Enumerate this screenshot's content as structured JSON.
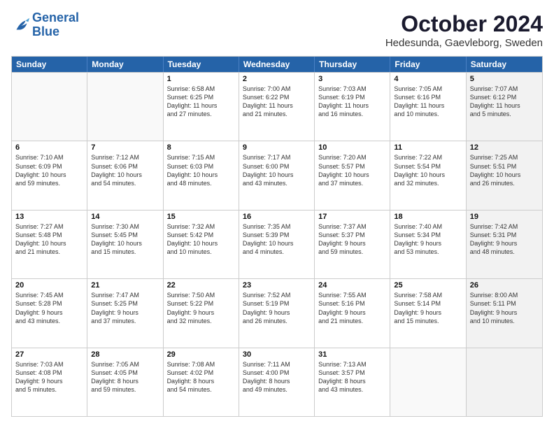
{
  "header": {
    "logo_general": "General",
    "logo_blue": "Blue",
    "month_title": "October 2024",
    "location": "Hedesunda, Gaevleborg, Sweden"
  },
  "weekdays": [
    "Sunday",
    "Monday",
    "Tuesday",
    "Wednesday",
    "Thursday",
    "Friday",
    "Saturday"
  ],
  "rows": [
    [
      {
        "day": "",
        "lines": [],
        "shaded": false,
        "empty": true
      },
      {
        "day": "",
        "lines": [],
        "shaded": false,
        "empty": true
      },
      {
        "day": "1",
        "lines": [
          "Sunrise: 6:58 AM",
          "Sunset: 6:25 PM",
          "Daylight: 11 hours",
          "and 27 minutes."
        ],
        "shaded": false,
        "empty": false
      },
      {
        "day": "2",
        "lines": [
          "Sunrise: 7:00 AM",
          "Sunset: 6:22 PM",
          "Daylight: 11 hours",
          "and 21 minutes."
        ],
        "shaded": false,
        "empty": false
      },
      {
        "day": "3",
        "lines": [
          "Sunrise: 7:03 AM",
          "Sunset: 6:19 PM",
          "Daylight: 11 hours",
          "and 16 minutes."
        ],
        "shaded": false,
        "empty": false
      },
      {
        "day": "4",
        "lines": [
          "Sunrise: 7:05 AM",
          "Sunset: 6:16 PM",
          "Daylight: 11 hours",
          "and 10 minutes."
        ],
        "shaded": false,
        "empty": false
      },
      {
        "day": "5",
        "lines": [
          "Sunrise: 7:07 AM",
          "Sunset: 6:12 PM",
          "Daylight: 11 hours",
          "and 5 minutes."
        ],
        "shaded": true,
        "empty": false
      }
    ],
    [
      {
        "day": "6",
        "lines": [
          "Sunrise: 7:10 AM",
          "Sunset: 6:09 PM",
          "Daylight: 10 hours",
          "and 59 minutes."
        ],
        "shaded": false,
        "empty": false
      },
      {
        "day": "7",
        "lines": [
          "Sunrise: 7:12 AM",
          "Sunset: 6:06 PM",
          "Daylight: 10 hours",
          "and 54 minutes."
        ],
        "shaded": false,
        "empty": false
      },
      {
        "day": "8",
        "lines": [
          "Sunrise: 7:15 AM",
          "Sunset: 6:03 PM",
          "Daylight: 10 hours",
          "and 48 minutes."
        ],
        "shaded": false,
        "empty": false
      },
      {
        "day": "9",
        "lines": [
          "Sunrise: 7:17 AM",
          "Sunset: 6:00 PM",
          "Daylight: 10 hours",
          "and 43 minutes."
        ],
        "shaded": false,
        "empty": false
      },
      {
        "day": "10",
        "lines": [
          "Sunrise: 7:20 AM",
          "Sunset: 5:57 PM",
          "Daylight: 10 hours",
          "and 37 minutes."
        ],
        "shaded": false,
        "empty": false
      },
      {
        "day": "11",
        "lines": [
          "Sunrise: 7:22 AM",
          "Sunset: 5:54 PM",
          "Daylight: 10 hours",
          "and 32 minutes."
        ],
        "shaded": false,
        "empty": false
      },
      {
        "day": "12",
        "lines": [
          "Sunrise: 7:25 AM",
          "Sunset: 5:51 PM",
          "Daylight: 10 hours",
          "and 26 minutes."
        ],
        "shaded": true,
        "empty": false
      }
    ],
    [
      {
        "day": "13",
        "lines": [
          "Sunrise: 7:27 AM",
          "Sunset: 5:48 PM",
          "Daylight: 10 hours",
          "and 21 minutes."
        ],
        "shaded": false,
        "empty": false
      },
      {
        "day": "14",
        "lines": [
          "Sunrise: 7:30 AM",
          "Sunset: 5:45 PM",
          "Daylight: 10 hours",
          "and 15 minutes."
        ],
        "shaded": false,
        "empty": false
      },
      {
        "day": "15",
        "lines": [
          "Sunrise: 7:32 AM",
          "Sunset: 5:42 PM",
          "Daylight: 10 hours",
          "and 10 minutes."
        ],
        "shaded": false,
        "empty": false
      },
      {
        "day": "16",
        "lines": [
          "Sunrise: 7:35 AM",
          "Sunset: 5:39 PM",
          "Daylight: 10 hours",
          "and 4 minutes."
        ],
        "shaded": false,
        "empty": false
      },
      {
        "day": "17",
        "lines": [
          "Sunrise: 7:37 AM",
          "Sunset: 5:37 PM",
          "Daylight: 9 hours",
          "and 59 minutes."
        ],
        "shaded": false,
        "empty": false
      },
      {
        "day": "18",
        "lines": [
          "Sunrise: 7:40 AM",
          "Sunset: 5:34 PM",
          "Daylight: 9 hours",
          "and 53 minutes."
        ],
        "shaded": false,
        "empty": false
      },
      {
        "day": "19",
        "lines": [
          "Sunrise: 7:42 AM",
          "Sunset: 5:31 PM",
          "Daylight: 9 hours",
          "and 48 minutes."
        ],
        "shaded": true,
        "empty": false
      }
    ],
    [
      {
        "day": "20",
        "lines": [
          "Sunrise: 7:45 AM",
          "Sunset: 5:28 PM",
          "Daylight: 9 hours",
          "and 43 minutes."
        ],
        "shaded": false,
        "empty": false
      },
      {
        "day": "21",
        "lines": [
          "Sunrise: 7:47 AM",
          "Sunset: 5:25 PM",
          "Daylight: 9 hours",
          "and 37 minutes."
        ],
        "shaded": false,
        "empty": false
      },
      {
        "day": "22",
        "lines": [
          "Sunrise: 7:50 AM",
          "Sunset: 5:22 PM",
          "Daylight: 9 hours",
          "and 32 minutes."
        ],
        "shaded": false,
        "empty": false
      },
      {
        "day": "23",
        "lines": [
          "Sunrise: 7:52 AM",
          "Sunset: 5:19 PM",
          "Daylight: 9 hours",
          "and 26 minutes."
        ],
        "shaded": false,
        "empty": false
      },
      {
        "day": "24",
        "lines": [
          "Sunrise: 7:55 AM",
          "Sunset: 5:16 PM",
          "Daylight: 9 hours",
          "and 21 minutes."
        ],
        "shaded": false,
        "empty": false
      },
      {
        "day": "25",
        "lines": [
          "Sunrise: 7:58 AM",
          "Sunset: 5:14 PM",
          "Daylight: 9 hours",
          "and 15 minutes."
        ],
        "shaded": false,
        "empty": false
      },
      {
        "day": "26",
        "lines": [
          "Sunrise: 8:00 AM",
          "Sunset: 5:11 PM",
          "Daylight: 9 hours",
          "and 10 minutes."
        ],
        "shaded": true,
        "empty": false
      }
    ],
    [
      {
        "day": "27",
        "lines": [
          "Sunrise: 7:03 AM",
          "Sunset: 4:08 PM",
          "Daylight: 9 hours",
          "and 5 minutes."
        ],
        "shaded": false,
        "empty": false
      },
      {
        "day": "28",
        "lines": [
          "Sunrise: 7:05 AM",
          "Sunset: 4:05 PM",
          "Daylight: 8 hours",
          "and 59 minutes."
        ],
        "shaded": false,
        "empty": false
      },
      {
        "day": "29",
        "lines": [
          "Sunrise: 7:08 AM",
          "Sunset: 4:02 PM",
          "Daylight: 8 hours",
          "and 54 minutes."
        ],
        "shaded": false,
        "empty": false
      },
      {
        "day": "30",
        "lines": [
          "Sunrise: 7:11 AM",
          "Sunset: 4:00 PM",
          "Daylight: 8 hours",
          "and 49 minutes."
        ],
        "shaded": false,
        "empty": false
      },
      {
        "day": "31",
        "lines": [
          "Sunrise: 7:13 AM",
          "Sunset: 3:57 PM",
          "Daylight: 8 hours",
          "and 43 minutes."
        ],
        "shaded": false,
        "empty": false
      },
      {
        "day": "",
        "lines": [],
        "shaded": false,
        "empty": true
      },
      {
        "day": "",
        "lines": [],
        "shaded": true,
        "empty": true
      }
    ]
  ]
}
